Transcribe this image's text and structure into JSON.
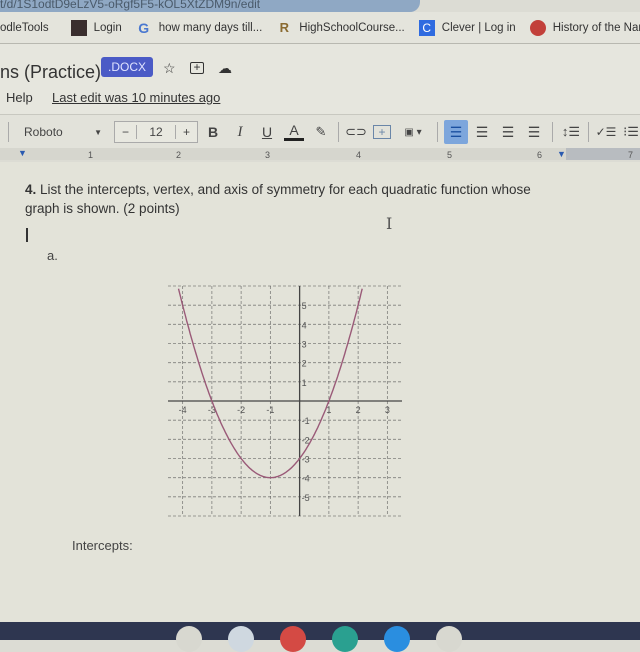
{
  "browser": {
    "url_fragment": "t/d/1S1odtD9eLzV5-oRgf5F5-kOL5XtZDM9n/edit",
    "bookmarks": [
      {
        "label": "odleTools",
        "icon": "none",
        "color": ""
      },
      {
        "label": "Login",
        "icon": "square-icon",
        "color": "#3a2e2e"
      },
      {
        "label": "how many days till...",
        "icon": "google-g-icon",
        "color": "#4a78d0"
      },
      {
        "label": "HighSchoolCourse...",
        "icon": "r-logo-icon",
        "color": "#8a6a30"
      },
      {
        "label": "Clever | Log in",
        "icon": "clever-c-icon",
        "color": "#2f6be0"
      },
      {
        "label": "History of the Nam...",
        "icon": "red-bird-icon",
        "color": "#c2403a"
      }
    ]
  },
  "document": {
    "title": "ns (Practice)",
    "badge": ".DOCX",
    "menu_help": "Help",
    "last_edit": "Last edit was 10 minutes ago"
  },
  "toolbar": {
    "font": "Roboto",
    "font_size": "12",
    "minus": "−",
    "plus": "+",
    "bold": "B",
    "italic": "I",
    "underline": "U",
    "text_color": "A",
    "text_color_value": "#222222"
  },
  "ruler": {
    "marks": [
      "1",
      "2",
      "3",
      "4",
      "5",
      "6",
      "7"
    ]
  },
  "content": {
    "question_number": "4.",
    "question_text": " List the intercepts, vertex, and axis of symmetry for each quadratic function whose graph is shown. (2 points)",
    "part_label": "a.",
    "intercepts_label": "Intercepts:"
  },
  "graph": {
    "function": "x^2 + 2x - 3",
    "coefficients": {
      "a": 1,
      "b": 2,
      "c": -3
    },
    "x_range": [
      -4.5,
      3.5
    ],
    "y_range": [
      -6,
      6
    ],
    "x_ticks": [
      "-4",
      "-3",
      "-2",
      "-1",
      "1",
      "2",
      "3"
    ],
    "y_ticks": [
      "5",
      "4",
      "3",
      "2",
      "1",
      "-1",
      "-2",
      "-3",
      "-4",
      "-5"
    ],
    "curve_color": "#9a5a78",
    "grid_color": "#555555"
  }
}
